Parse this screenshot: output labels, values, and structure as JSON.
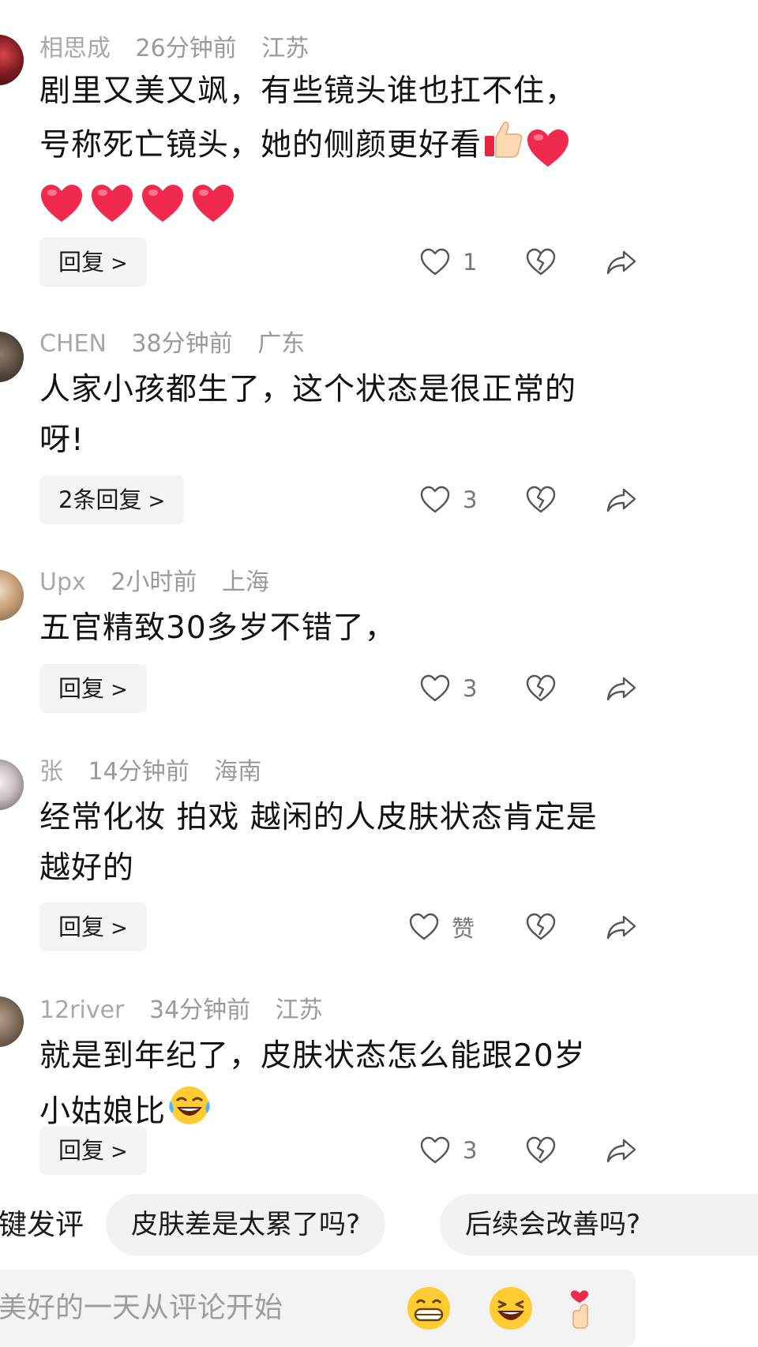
{
  "comments": [
    {
      "user": "相思成",
      "time": "26分钟前",
      "location": "江苏",
      "text_lines": [
        "剧里又美又飒，有些镜头谁也扛不住，",
        "号称死亡镜头，她的侧颜更好看"
      ],
      "emoji_names": [
        "thumbs-up-emoji",
        "red-heart-emoji",
        "red-heart-emoji",
        "red-heart-emoji",
        "red-heart-emoji",
        "red-heart-emoji"
      ],
      "reply_label": "回复",
      "likes": "1"
    },
    {
      "user": "CHEN",
      "time": "38分钟前",
      "location": "广东",
      "text_lines": [
        "人家小孩都生了，这个状态是很正常的",
        "呀!"
      ],
      "reply_label": "2条回复",
      "likes": "3"
    },
    {
      "user": "Upx",
      "time": "2小时前",
      "location": "上海",
      "text_lines": [
        "五官精致30多岁不错了，"
      ],
      "reply_label": "回复",
      "likes": "3"
    },
    {
      "user": "张",
      "time": "14分钟前",
      "location": "海南",
      "text_lines": [
        "经常化妆 拍戏 越闲的人皮肤状态肯定是",
        "越好的"
      ],
      "reply_label": "回复",
      "likes": "赞"
    },
    {
      "user": "12river",
      "time": "34分钟前",
      "location": "江苏",
      "text_lines": [
        "就是到年纪了，皮肤状态怎么能跟20岁",
        "小姑娘比"
      ],
      "emoji_names": [
        "laughing-crying-emoji"
      ],
      "reply_label": "回复",
      "likes": "3"
    }
  ],
  "quick_comment": {
    "label": "键发评",
    "chips": [
      "皮肤差是太累了吗?",
      "后续会改善吗?"
    ]
  },
  "input": {
    "placeholder": "美好的一天从评论开始",
    "emoji_names": [
      "grinning-emoji",
      "laughing-emoji",
      "finger-heart-emoji"
    ]
  },
  "colors": {
    "meta_text": "#9a9a9a",
    "chip_bg": "#f2f2f2",
    "heart_red": "#f0294f"
  }
}
